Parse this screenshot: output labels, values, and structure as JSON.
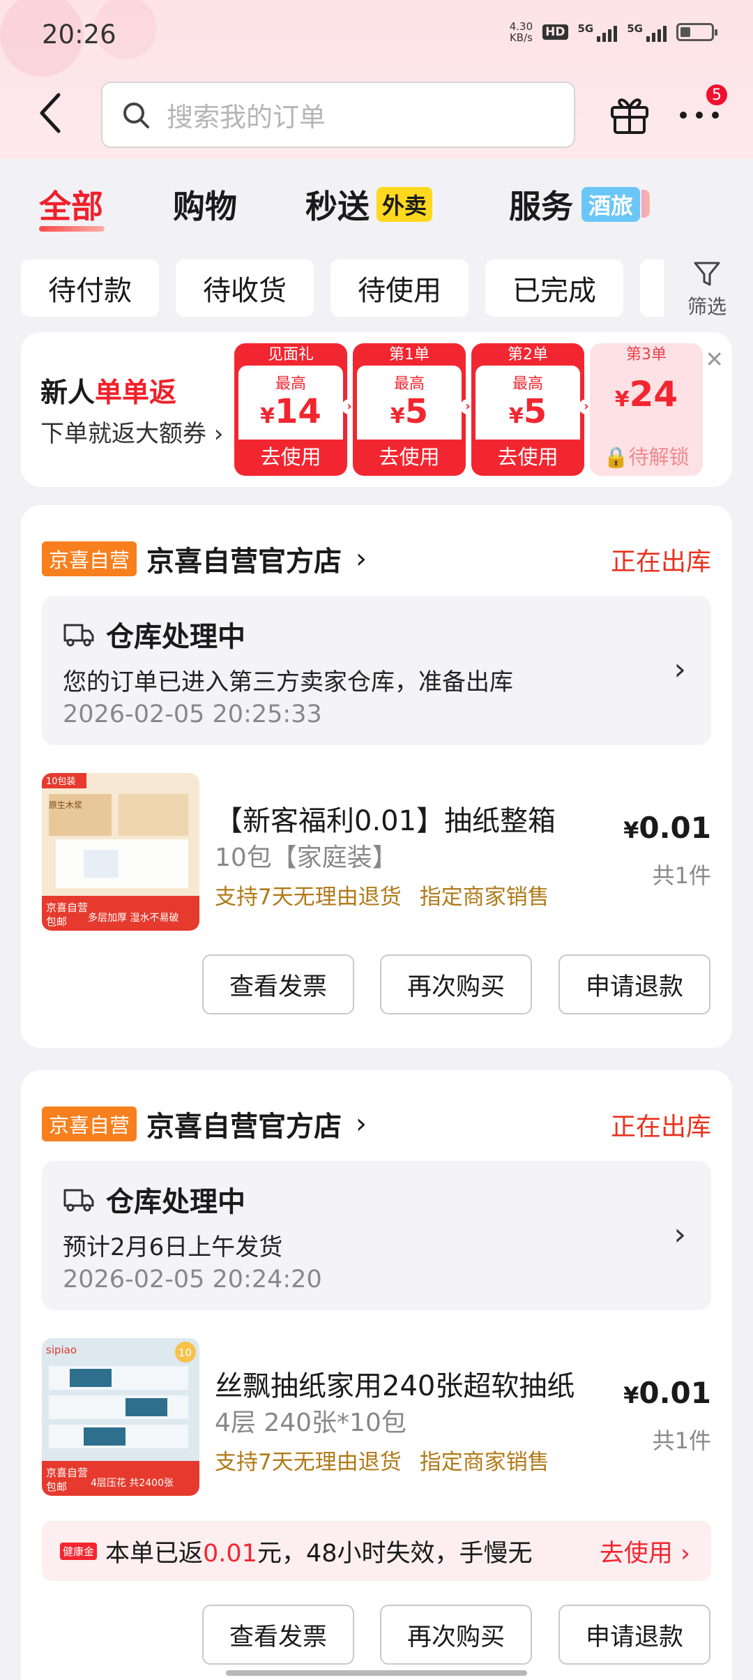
{
  "status_bar": {
    "time": "20:26",
    "net_speed_value": "4.30",
    "net_speed_unit": "KB/s",
    "hd_label": "HD",
    "sim1_label": "5G",
    "sim2_label": "5G"
  },
  "header": {
    "search_placeholder": "搜索我的订单",
    "notification_count": "5"
  },
  "tabs": [
    {
      "label": "全部"
    },
    {
      "label": "购物"
    },
    {
      "label": "秒送",
      "tag": "外卖"
    },
    {
      "label": "服务",
      "tag": "酒旅"
    }
  ],
  "filter_chips": [
    "待付款",
    "待收货",
    "待使用",
    "已完成"
  ],
  "filter_button_label": "筛选",
  "promo": {
    "title_black": "新人",
    "title_red": "单单返",
    "subtitle": "下单就返大额券",
    "coupons": [
      {
        "head": "见面礼",
        "top": "最高",
        "currency": "¥",
        "amount": "14",
        "button": "去使用"
      },
      {
        "head": "第1单",
        "top": "最高",
        "currency": "¥",
        "amount": "5",
        "button": "去使用"
      },
      {
        "head": "第2单",
        "top": "最高",
        "currency": "¥",
        "amount": "5",
        "button": "去使用"
      },
      {
        "head": "第3单",
        "currency": "¥",
        "amount": "24",
        "button": "待解锁"
      }
    ]
  },
  "orders": [
    {
      "store_tag": "京喜自营",
      "store_name": "京喜自营官方店",
      "status": "正在出库",
      "ship_title": "仓库处理中",
      "ship_desc": "您的订单已进入第三方卖家仓库，准备出库",
      "ship_time": "2026-02-05 20:25:33",
      "product_title": "【新客福利0.01】抽纸整箱",
      "product_spec": "10包【家庭装】",
      "tags": [
        "支持7天无理由退货",
        "指定商家销售"
      ],
      "price_symbol": "¥",
      "price": "0.01",
      "qty": "共1件",
      "thumb_badge": "10包装",
      "thumb_brand": "原生木浆",
      "thumb_footer": "多层加厚 湿水不易破",
      "thumb_corner": "京喜自营\n包邮",
      "buttons": [
        "查看发票",
        "再次购买",
        "申请退款"
      ]
    },
    {
      "store_tag": "京喜自营",
      "store_name": "京喜自营官方店",
      "status": "正在出库",
      "ship_title": "仓库处理中",
      "ship_desc": "预计2月6日上午发货",
      "ship_time": "2026-02-05 20:24:20",
      "product_title": "丝飘抽纸家用240张超软抽纸",
      "product_spec": "4层 240张*10包",
      "tags": [
        "支持7天无理由退货",
        "指定商家销售"
      ],
      "price_symbol": "¥",
      "price": "0.01",
      "qty": "共1件",
      "thumb_badge": "10",
      "thumb_brand": "sipiao",
      "thumb_footer": "4层压花 共2400张",
      "thumb_corner": "京喜自营\n包邮",
      "rebate_icon": "健康金",
      "rebate_before": "本单已返",
      "rebate_amount": "0.01",
      "rebate_after": "元，48小时失效，手慢无",
      "rebate_action": "去使用",
      "buttons": [
        "查看发票",
        "再次购买",
        "申请退款"
      ]
    }
  ],
  "colors": {
    "accent_red": "#f0202a",
    "status_orange": "#e8321e",
    "store_tag_orange": "#f77f1d",
    "service_tag_gold": "#b07a18"
  }
}
